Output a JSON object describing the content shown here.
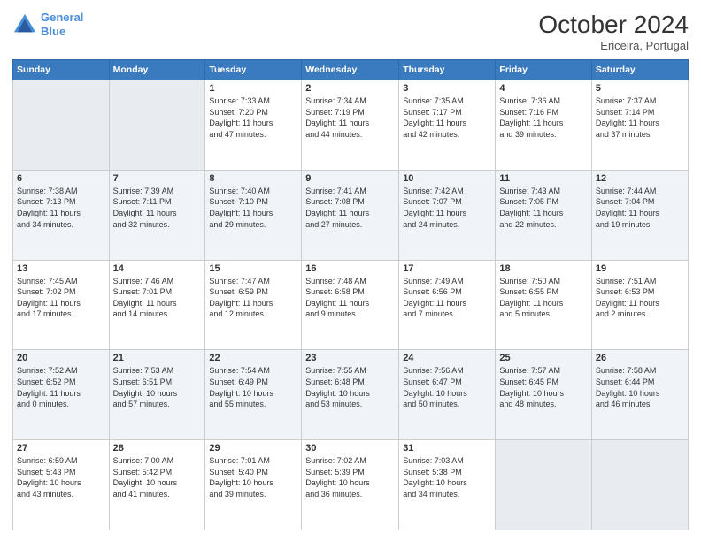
{
  "header": {
    "logo_line1": "General",
    "logo_line2": "Blue",
    "month_title": "October 2024",
    "location": "Ericeira, Portugal"
  },
  "days_of_week": [
    "Sunday",
    "Monday",
    "Tuesday",
    "Wednesday",
    "Thursday",
    "Friday",
    "Saturday"
  ],
  "weeks": [
    [
      {
        "day": "",
        "info": ""
      },
      {
        "day": "",
        "info": ""
      },
      {
        "day": "1",
        "info": "Sunrise: 7:33 AM\nSunset: 7:20 PM\nDaylight: 11 hours\nand 47 minutes."
      },
      {
        "day": "2",
        "info": "Sunrise: 7:34 AM\nSunset: 7:19 PM\nDaylight: 11 hours\nand 44 minutes."
      },
      {
        "day": "3",
        "info": "Sunrise: 7:35 AM\nSunset: 7:17 PM\nDaylight: 11 hours\nand 42 minutes."
      },
      {
        "day": "4",
        "info": "Sunrise: 7:36 AM\nSunset: 7:16 PM\nDaylight: 11 hours\nand 39 minutes."
      },
      {
        "day": "5",
        "info": "Sunrise: 7:37 AM\nSunset: 7:14 PM\nDaylight: 11 hours\nand 37 minutes."
      }
    ],
    [
      {
        "day": "6",
        "info": "Sunrise: 7:38 AM\nSunset: 7:13 PM\nDaylight: 11 hours\nand 34 minutes."
      },
      {
        "day": "7",
        "info": "Sunrise: 7:39 AM\nSunset: 7:11 PM\nDaylight: 11 hours\nand 32 minutes."
      },
      {
        "day": "8",
        "info": "Sunrise: 7:40 AM\nSunset: 7:10 PM\nDaylight: 11 hours\nand 29 minutes."
      },
      {
        "day": "9",
        "info": "Sunrise: 7:41 AM\nSunset: 7:08 PM\nDaylight: 11 hours\nand 27 minutes."
      },
      {
        "day": "10",
        "info": "Sunrise: 7:42 AM\nSunset: 7:07 PM\nDaylight: 11 hours\nand 24 minutes."
      },
      {
        "day": "11",
        "info": "Sunrise: 7:43 AM\nSunset: 7:05 PM\nDaylight: 11 hours\nand 22 minutes."
      },
      {
        "day": "12",
        "info": "Sunrise: 7:44 AM\nSunset: 7:04 PM\nDaylight: 11 hours\nand 19 minutes."
      }
    ],
    [
      {
        "day": "13",
        "info": "Sunrise: 7:45 AM\nSunset: 7:02 PM\nDaylight: 11 hours\nand 17 minutes."
      },
      {
        "day": "14",
        "info": "Sunrise: 7:46 AM\nSunset: 7:01 PM\nDaylight: 11 hours\nand 14 minutes."
      },
      {
        "day": "15",
        "info": "Sunrise: 7:47 AM\nSunset: 6:59 PM\nDaylight: 11 hours\nand 12 minutes."
      },
      {
        "day": "16",
        "info": "Sunrise: 7:48 AM\nSunset: 6:58 PM\nDaylight: 11 hours\nand 9 minutes."
      },
      {
        "day": "17",
        "info": "Sunrise: 7:49 AM\nSunset: 6:56 PM\nDaylight: 11 hours\nand 7 minutes."
      },
      {
        "day": "18",
        "info": "Sunrise: 7:50 AM\nSunset: 6:55 PM\nDaylight: 11 hours\nand 5 minutes."
      },
      {
        "day": "19",
        "info": "Sunrise: 7:51 AM\nSunset: 6:53 PM\nDaylight: 11 hours\nand 2 minutes."
      }
    ],
    [
      {
        "day": "20",
        "info": "Sunrise: 7:52 AM\nSunset: 6:52 PM\nDaylight: 11 hours\nand 0 minutes."
      },
      {
        "day": "21",
        "info": "Sunrise: 7:53 AM\nSunset: 6:51 PM\nDaylight: 10 hours\nand 57 minutes."
      },
      {
        "day": "22",
        "info": "Sunrise: 7:54 AM\nSunset: 6:49 PM\nDaylight: 10 hours\nand 55 minutes."
      },
      {
        "day": "23",
        "info": "Sunrise: 7:55 AM\nSunset: 6:48 PM\nDaylight: 10 hours\nand 53 minutes."
      },
      {
        "day": "24",
        "info": "Sunrise: 7:56 AM\nSunset: 6:47 PM\nDaylight: 10 hours\nand 50 minutes."
      },
      {
        "day": "25",
        "info": "Sunrise: 7:57 AM\nSunset: 6:45 PM\nDaylight: 10 hours\nand 48 minutes."
      },
      {
        "day": "26",
        "info": "Sunrise: 7:58 AM\nSunset: 6:44 PM\nDaylight: 10 hours\nand 46 minutes."
      }
    ],
    [
      {
        "day": "27",
        "info": "Sunrise: 6:59 AM\nSunset: 5:43 PM\nDaylight: 10 hours\nand 43 minutes."
      },
      {
        "day": "28",
        "info": "Sunrise: 7:00 AM\nSunset: 5:42 PM\nDaylight: 10 hours\nand 41 minutes."
      },
      {
        "day": "29",
        "info": "Sunrise: 7:01 AM\nSunset: 5:40 PM\nDaylight: 10 hours\nand 39 minutes."
      },
      {
        "day": "30",
        "info": "Sunrise: 7:02 AM\nSunset: 5:39 PM\nDaylight: 10 hours\nand 36 minutes."
      },
      {
        "day": "31",
        "info": "Sunrise: 7:03 AM\nSunset: 5:38 PM\nDaylight: 10 hours\nand 34 minutes."
      },
      {
        "day": "",
        "info": ""
      },
      {
        "day": "",
        "info": ""
      }
    ]
  ]
}
